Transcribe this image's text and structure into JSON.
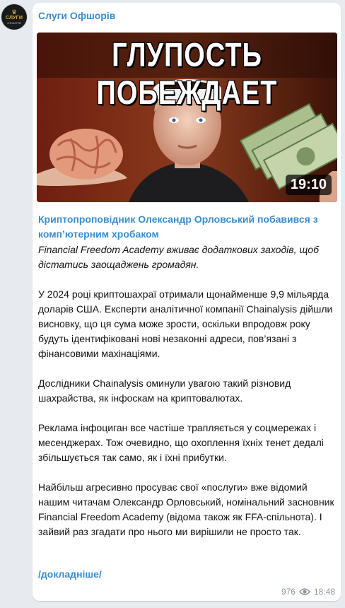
{
  "channel": {
    "name": "Слуги Офшорів"
  },
  "avatar": {
    "text": "СЛУГИ",
    "subtext": "ОФШОРІВ"
  },
  "media": {
    "title_text": "ГЛУПОСТЬ ПОБЕЖДАЕТ",
    "duration": "19:10"
  },
  "post": {
    "headline": "Криптопроповідник Олександр Орловський побавився з комп’ютерним хробаком",
    "lead": "Financial Freedom Academy вживає додаткових заходів, щоб дістатись заощаджень громадян.",
    "paragraphs": [
      "У 2024 році криптошахраї отримали щонайменше 9,9 мільярда доларів США. Експерти аналітичної компанії Chainalysis дійшли висновку, що ця сума може зрости, оскільки впродовж року будуть ідентифіковані нові незаконні адреси, пов’язані з фінансовими махінаціями.",
      "Дослідники Chainalysis оминули увагою такий різновид шахрайства, як інфоскам на криптовалютах.",
      "Реклама інфоциган все частіше трапляється у соцмережах і месенджерах. Тож очевидно, що охоплення їхніх тенет дедалі збільшується так само, як і їхні прибутки.",
      "Найбільш агресивно просуває свої «послуги» вже відомий нашим читачам Олександр Орловський, номінальний засновник Financial Freedom Academy (відома також як FFA-спільнота). І зайвий раз згадати про нього ми вирішили не просто так."
    ],
    "more_link": "/докладніше/",
    "views": "976",
    "time": "18:48"
  },
  "colors": {
    "accent": "#3a8ccd",
    "background": "#e7ebf0",
    "meta": "#8d969c"
  },
  "icons": {
    "views": "eye-icon"
  }
}
